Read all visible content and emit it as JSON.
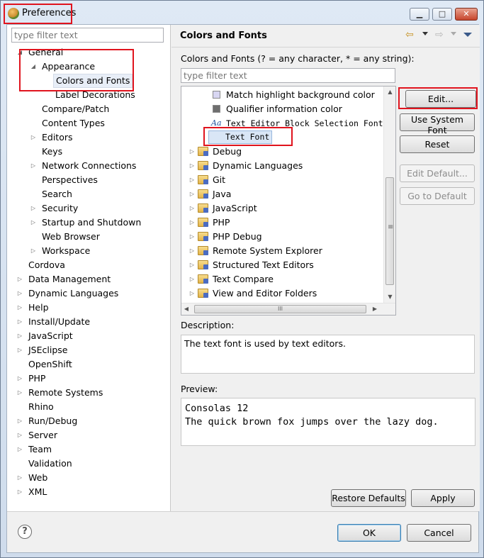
{
  "window": {
    "title": "Preferences",
    "controls": {
      "minimize": "▁",
      "maximize": "□",
      "close": "✕"
    }
  },
  "left": {
    "filter_placeholder": "type filter text",
    "tree": [
      {
        "label": "General",
        "indent": 0,
        "twisty": "expanded"
      },
      {
        "label": "Appearance",
        "indent": 1,
        "twisty": "expanded"
      },
      {
        "label": "Colors and Fonts",
        "indent": 2,
        "twisty": "none",
        "selected": true
      },
      {
        "label": "Label Decorations",
        "indent": 2,
        "twisty": "none"
      },
      {
        "label": "Compare/Patch",
        "indent": 1,
        "twisty": "none"
      },
      {
        "label": "Content Types",
        "indent": 1,
        "twisty": "none"
      },
      {
        "label": "Editors",
        "indent": 1,
        "twisty": "collapsed"
      },
      {
        "label": "Keys",
        "indent": 1,
        "twisty": "none"
      },
      {
        "label": "Network Connections",
        "indent": 1,
        "twisty": "collapsed"
      },
      {
        "label": "Perspectives",
        "indent": 1,
        "twisty": "none"
      },
      {
        "label": "Search",
        "indent": 1,
        "twisty": "none"
      },
      {
        "label": "Security",
        "indent": 1,
        "twisty": "collapsed"
      },
      {
        "label": "Startup and Shutdown",
        "indent": 1,
        "twisty": "collapsed"
      },
      {
        "label": "Web Browser",
        "indent": 1,
        "twisty": "none"
      },
      {
        "label": "Workspace",
        "indent": 1,
        "twisty": "collapsed"
      },
      {
        "label": "Cordova",
        "indent": 0,
        "twisty": "none"
      },
      {
        "label": "Data Management",
        "indent": 0,
        "twisty": "collapsed"
      },
      {
        "label": "Dynamic Languages",
        "indent": 0,
        "twisty": "collapsed"
      },
      {
        "label": "Help",
        "indent": 0,
        "twisty": "collapsed"
      },
      {
        "label": "Install/Update",
        "indent": 0,
        "twisty": "collapsed"
      },
      {
        "label": "JavaScript",
        "indent": 0,
        "twisty": "collapsed"
      },
      {
        "label": "JSEclipse",
        "indent": 0,
        "twisty": "collapsed"
      },
      {
        "label": "OpenShift",
        "indent": 0,
        "twisty": "none"
      },
      {
        "label": "PHP",
        "indent": 0,
        "twisty": "collapsed"
      },
      {
        "label": "Remote Systems",
        "indent": 0,
        "twisty": "collapsed"
      },
      {
        "label": "Rhino",
        "indent": 0,
        "twisty": "none"
      },
      {
        "label": "Run/Debug",
        "indent": 0,
        "twisty": "collapsed"
      },
      {
        "label": "Server",
        "indent": 0,
        "twisty": "collapsed"
      },
      {
        "label": "Team",
        "indent": 0,
        "twisty": "collapsed"
      },
      {
        "label": "Validation",
        "indent": 0,
        "twisty": "none"
      },
      {
        "label": "Web",
        "indent": 0,
        "twisty": "collapsed"
      },
      {
        "label": "XML",
        "indent": 0,
        "twisty": "collapsed"
      }
    ]
  },
  "right": {
    "page_title": "Colors and Fonts",
    "filter_hint": "Colors and Fonts (? = any character, * = any string):",
    "filter_placeholder": "type filter text",
    "items": [
      {
        "label": "Match highlight background color",
        "kind": "color",
        "color": "#d8d6f2"
      },
      {
        "label": "Qualifier information color",
        "kind": "color",
        "color": "#6e6e6e"
      },
      {
        "label": "Text Editor Block Selection Font",
        "kind": "font"
      },
      {
        "label": "Text Font",
        "kind": "font",
        "selected": true
      },
      {
        "label": "Debug",
        "kind": "folder"
      },
      {
        "label": "Dynamic Languages",
        "kind": "folder"
      },
      {
        "label": "Git",
        "kind": "folder"
      },
      {
        "label": "Java",
        "kind": "folder"
      },
      {
        "label": "JavaScript",
        "kind": "folder"
      },
      {
        "label": "PHP",
        "kind": "folder"
      },
      {
        "label": "PHP Debug",
        "kind": "folder"
      },
      {
        "label": "Remote System Explorer",
        "kind": "folder"
      },
      {
        "label": "Structured Text Editors",
        "kind": "folder"
      },
      {
        "label": "Text Compare",
        "kind": "folder"
      },
      {
        "label": "View and Editor Folders",
        "kind": "folder"
      }
    ],
    "font_glyph": "Aa",
    "buttons": {
      "edit": "Edit...",
      "use_system_font": "Use System Font",
      "reset": "Reset",
      "edit_default": "Edit Default...",
      "go_to_default": "Go to Default"
    },
    "description_label": "Description:",
    "description": "The text font is used by text editors.",
    "preview_label": "Preview:",
    "preview_lines": [
      "Consolas 12",
      "The quick brown fox jumps over the lazy dog."
    ],
    "restore_defaults": "Restore Defaults",
    "apply": "Apply"
  },
  "footer": {
    "help": "?",
    "ok": "OK",
    "cancel": "Cancel"
  },
  "scroll": {
    "hgrip": "III",
    "vgrip": "≡"
  }
}
